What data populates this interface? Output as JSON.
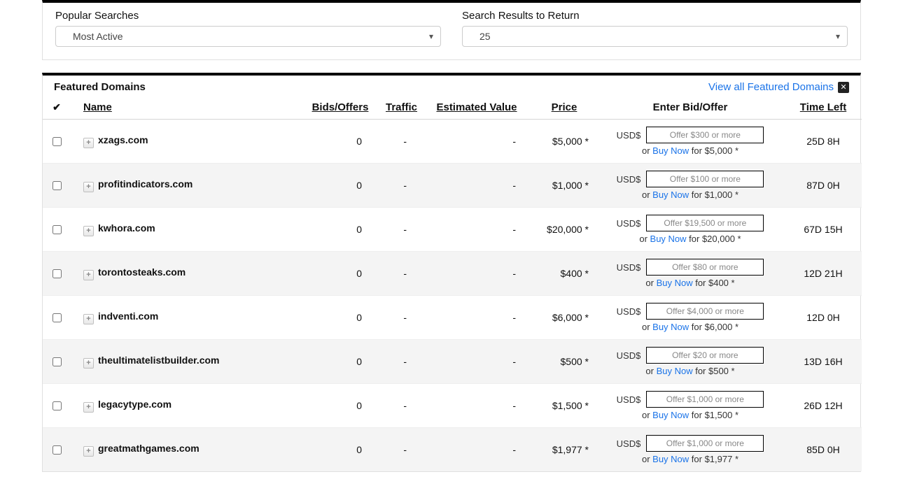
{
  "search": {
    "popular_label": "Popular Searches",
    "popular_value": "Most Active",
    "results_label": "Search Results to Return",
    "results_value": "25"
  },
  "featured": {
    "title": "Featured Domains",
    "view_all": "View all Featured Domains",
    "headers": {
      "name": "Name",
      "bids": "Bids/Offers",
      "traffic": "Traffic",
      "est": "Estimated Value",
      "price": "Price",
      "bidoffer": "Enter Bid/Offer",
      "time": "Time Left"
    },
    "currency": "USD$",
    "or_text": "or",
    "buy_now": "Buy Now",
    "for_text": "for",
    "rows": [
      {
        "name": "xzags.com",
        "bids": "0",
        "traffic": "-",
        "est": "-",
        "price": "$5,000 *",
        "placeholder": "Offer $300 or more",
        "buy_price": "$5,000 *",
        "time": "25D 8H"
      },
      {
        "name": "profitindicators.com",
        "bids": "0",
        "traffic": "-",
        "est": "-",
        "price": "$1,000 *",
        "placeholder": "Offer $100 or more",
        "buy_price": "$1,000 *",
        "time": "87D 0H"
      },
      {
        "name": "kwhora.com",
        "bids": "0",
        "traffic": "-",
        "est": "-",
        "price": "$20,000 *",
        "placeholder": "Offer $19,500 or more",
        "buy_price": "$20,000 *",
        "time": "67D 15H"
      },
      {
        "name": "torontosteaks.com",
        "bids": "0",
        "traffic": "-",
        "est": "-",
        "price": "$400 *",
        "placeholder": "Offer $80 or more",
        "buy_price": "$400 *",
        "time": "12D 21H"
      },
      {
        "name": "indventi.com",
        "bids": "0",
        "traffic": "-",
        "est": "-",
        "price": "$6,000 *",
        "placeholder": "Offer $4,000 or more",
        "buy_price": "$6,000 *",
        "time": "12D 0H"
      },
      {
        "name": "theultimatelistbuilder.com",
        "bids": "0",
        "traffic": "-",
        "est": "-",
        "price": "$500 *",
        "placeholder": "Offer $20 or more",
        "buy_price": "$500 *",
        "time": "13D 16H"
      },
      {
        "name": "legacytype.com",
        "bids": "0",
        "traffic": "-",
        "est": "-",
        "price": "$1,500 *",
        "placeholder": "Offer $1,000 or more",
        "buy_price": "$1,500 *",
        "time": "26D 12H"
      },
      {
        "name": "greatmathgames.com",
        "bids": "0",
        "traffic": "-",
        "est": "-",
        "price": "$1,977 *",
        "placeholder": "Offer $1,000 or more",
        "buy_price": "$1,977 *",
        "time": "85D 0H"
      }
    ]
  }
}
